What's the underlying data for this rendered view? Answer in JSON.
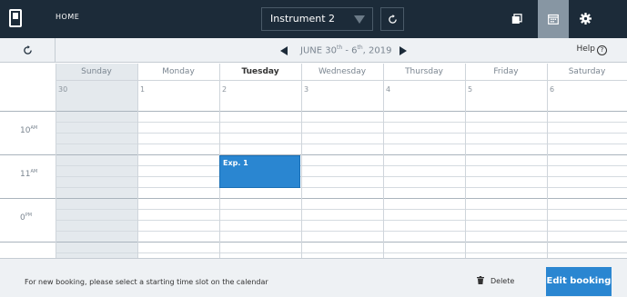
{
  "topbar": {
    "home_label": "HOME",
    "instrument": "Instrument 2",
    "icons": [
      "device-icon",
      "refresh-icon",
      "copy-icon",
      "calendar-icon",
      "gear-icon"
    ]
  },
  "subheader": {
    "date_month": "JUNE 30",
    "date_sup1": "th",
    "date_mid": " - 6",
    "date_sup2": "th",
    "date_year": ", 2019",
    "help_label": "Help"
  },
  "calendar": {
    "days": [
      {
        "name": "Sunday",
        "num": "30"
      },
      {
        "name": "Monday",
        "num": "1"
      },
      {
        "name": "Tuesday",
        "num": "2"
      },
      {
        "name": "Wednesday",
        "num": "3"
      },
      {
        "name": "Thursday",
        "num": "4"
      },
      {
        "name": "Friday",
        "num": "5"
      },
      {
        "name": "Saturday",
        "num": "6"
      }
    ],
    "hours": [
      {
        "num": "10",
        "suffix": "AM"
      },
      {
        "num": "11",
        "suffix": "AM"
      },
      {
        "num": "0",
        "suffix": "PM"
      }
    ],
    "event": {
      "title": "Exp. 1",
      "day": "Tuesday"
    }
  },
  "footer": {
    "note": "For new booking, please select a starting time slot on the calendar",
    "delete_label": "Delete",
    "edit_label": "Edit booking"
  },
  "colors": {
    "topbar": "#1c2b39",
    "accent": "#2a86d1",
    "active_tab": "#8796a3"
  }
}
